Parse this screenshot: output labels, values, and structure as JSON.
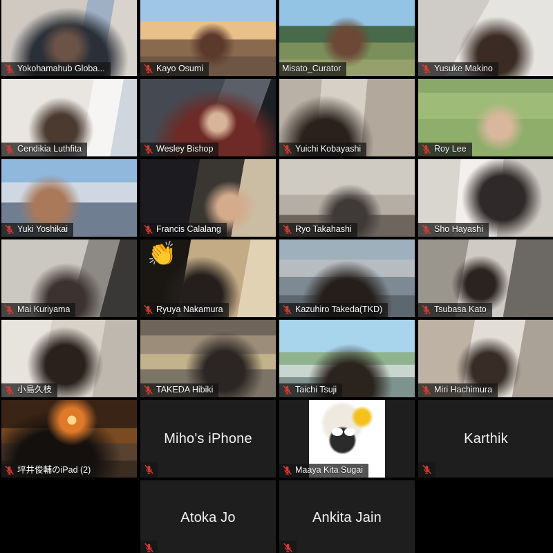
{
  "app": {
    "name": "Zoom Gallery View",
    "layout": "gallery-grid",
    "columns": 4,
    "rows": 7
  },
  "colors": {
    "background": "#000000",
    "tile_video_off": "#1e1e1e",
    "active_speaker_border": "#c9db4e",
    "mute_icon": "#d93b30",
    "name_text": "#ffffff"
  },
  "icons": {
    "muted": "mic-muted-icon"
  },
  "participants": [
    {
      "name": "Yokohamahub Globa...",
      "muted": true,
      "video": true,
      "active_speaker": false,
      "scene": "sc-office-w",
      "row": 1,
      "col": 1
    },
    {
      "name": "Kayo Osumi",
      "muted": true,
      "video": true,
      "active_speaker": false,
      "scene": "sc-taj",
      "row": 1,
      "col": 2
    },
    {
      "name": "Misato_Curator",
      "muted": false,
      "video": true,
      "active_speaker": true,
      "scene": "sc-lake",
      "row": 1,
      "col": 3
    },
    {
      "name": "Yusuke Makino",
      "muted": true,
      "video": true,
      "active_speaker": false,
      "scene": "sc-white-room",
      "row": 1,
      "col": 4
    },
    {
      "name": "Cendikia Luthfita",
      "muted": true,
      "video": true,
      "active_speaker": false,
      "scene": "sc-bright-wall",
      "row": 2,
      "col": 1
    },
    {
      "name": "Wesley Bishop",
      "muted": true,
      "video": true,
      "active_speaker": false,
      "scene": "sc-dark-blue",
      "row": 2,
      "col": 2
    },
    {
      "name": "Yuichi Kobayashi",
      "muted": true,
      "video": true,
      "active_speaker": false,
      "scene": "sc-shelf-room",
      "row": 2,
      "col": 3
    },
    {
      "name": "Roy Lee",
      "muted": true,
      "video": true,
      "active_speaker": false,
      "scene": "sc-lawn",
      "row": 2,
      "col": 4
    },
    {
      "name": "Yuki Yoshikai",
      "muted": true,
      "video": true,
      "active_speaker": false,
      "scene": "sc-mosque",
      "row": 3,
      "col": 1
    },
    {
      "name": "Francis Calalang",
      "muted": true,
      "video": true,
      "active_speaker": false,
      "scene": "sc-dimroom",
      "row": 3,
      "col": 2
    },
    {
      "name": "Ryo Takahashi",
      "muted": true,
      "video": true,
      "active_speaker": false,
      "scene": "sc-ceiling",
      "row": 3,
      "col": 3
    },
    {
      "name": "Sho Hayashi",
      "muted": true,
      "video": true,
      "active_speaker": false,
      "scene": "sc-window",
      "row": 3,
      "col": 4
    },
    {
      "name": "Mai Kuriyama",
      "muted": true,
      "video": true,
      "active_speaker": false,
      "scene": "sc-grey-room",
      "row": 4,
      "col": 1
    },
    {
      "name": "Ryuya Nakamura",
      "muted": true,
      "video": true,
      "active_speaker": false,
      "scene": "sc-curtain",
      "row": 4,
      "col": 2,
      "reaction": "👏"
    },
    {
      "name": "Kazuhiro Takeda(TKD)",
      "muted": true,
      "video": true,
      "active_speaker": false,
      "scene": "sc-harbor",
      "row": 4,
      "col": 3
    },
    {
      "name": "Tsubasa Kato",
      "muted": true,
      "video": true,
      "active_speaker": false,
      "scene": "sc-openoffice",
      "row": 4,
      "col": 4
    },
    {
      "name": "小島久枝",
      "muted": true,
      "video": true,
      "active_speaker": false,
      "scene": "sc-sofa",
      "row": 5,
      "col": 1
    },
    {
      "name": "TAKEDA Hibiki",
      "muted": true,
      "video": true,
      "active_speaker": false,
      "scene": "sc-library",
      "row": 5,
      "col": 2
    },
    {
      "name": "Taichi Tsuji",
      "muted": true,
      "video": true,
      "active_speaker": false,
      "scene": "sc-beach",
      "row": 5,
      "col": 3
    },
    {
      "name": "Miri Hachimura",
      "muted": true,
      "video": true,
      "active_speaker": false,
      "scene": "sc-shelf2",
      "row": 5,
      "col": 4
    },
    {
      "name": "坪井俊輔のiPad (2)",
      "muted": true,
      "video": true,
      "active_speaker": false,
      "scene": "sc-sunset",
      "row": 6,
      "col": 1
    },
    {
      "name": "Miho's iPhone",
      "muted": true,
      "video": false,
      "active_speaker": false,
      "row": 6,
      "col": 2
    },
    {
      "name": "Maaya Kita Sugai",
      "muted": true,
      "video": false,
      "active_speaker": false,
      "avatar": "sheep-avatar",
      "row": 6,
      "col": 3
    },
    {
      "name": "Karthik",
      "muted": true,
      "video": false,
      "active_speaker": false,
      "row": 6,
      "col": 4
    },
    {
      "name": "Atoka Jo",
      "muted": true,
      "video": false,
      "active_speaker": false,
      "row": 7,
      "col": 2
    },
    {
      "name": "Ankita Jain",
      "muted": true,
      "video": false,
      "active_speaker": false,
      "row": 7,
      "col": 3
    }
  ],
  "empty_slots": [
    {
      "row": 7,
      "col": 1
    },
    {
      "row": 7,
      "col": 4
    }
  ]
}
